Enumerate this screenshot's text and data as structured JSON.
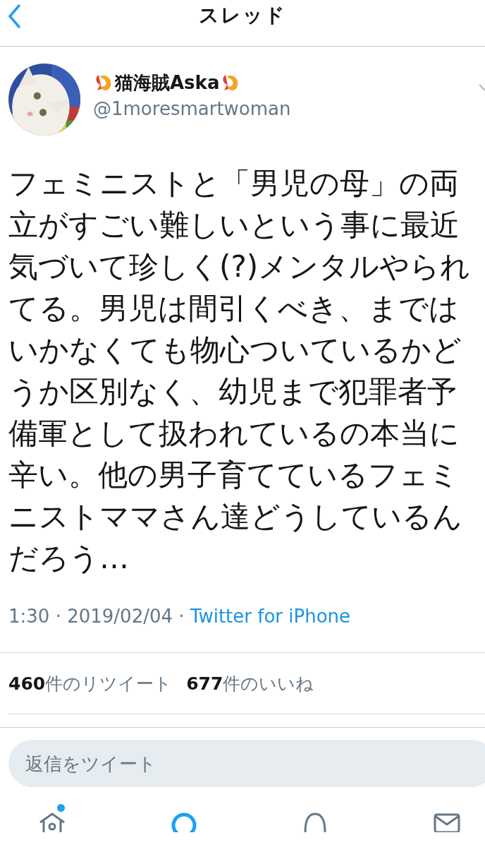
{
  "header": {
    "title": "スレッド"
  },
  "tweet": {
    "name": "猫海賊Aska",
    "handle": "@1moresmartwoman",
    "text": "フェミニストと「男児の母」の両立がすごい難しいという事に最近気づいて珍しく(?)メンタルやられてる。男児は間引くべき、まではいかなくても物心ついているかどうか区別なく、幼児まで犯罪者予備軍として扱われているの本当に辛い。他の男子育てているフェミニストママさん達どうしているんだろう…",
    "time": "1:30 · 2019/02/04 · ",
    "source": "Twitter for iPhone"
  },
  "stats": [
    {
      "count": "460",
      "label": "件のリツイート"
    },
    {
      "count": "677",
      "label": "件のいいね"
    }
  ],
  "reply": {
    "placeholder": "返信をツイート"
  },
  "tab_bar": [
    {
      "kind": "home",
      "selected": false,
      "dot": true
    },
    {
      "kind": "search",
      "selected": true,
      "dot": false
    },
    {
      "kind": "notifications",
      "selected": false,
      "dot": false
    },
    {
      "kind": "messages",
      "selected": false,
      "dot": false
    }
  ]
}
